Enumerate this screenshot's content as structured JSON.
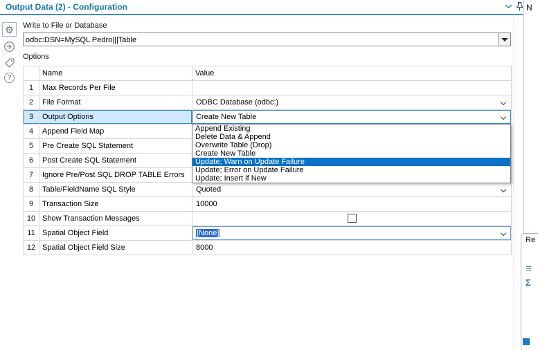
{
  "icons": {
    "gear": "⚙",
    "help": "?",
    "list": "≡",
    "sigma": "Σ"
  },
  "panel": {
    "title": "Output Data (2) - Configuration"
  },
  "write_section": {
    "label": "Write to File or Database",
    "connection_value": "odbc:DSN=MySQL Pedro|||Table"
  },
  "options_section": {
    "label": "Options",
    "headers": {
      "name": "Name",
      "value": "Value"
    },
    "rows": [
      {
        "num": "1",
        "name": "Max Records Per File",
        "value": ""
      },
      {
        "num": "2",
        "name": "File Format",
        "value": "ODBC Database (odbc:)"
      },
      {
        "num": "3",
        "name": "Output Options",
        "value": "Create New Table"
      },
      {
        "num": "4",
        "name": "Append Field Map",
        "value": ""
      },
      {
        "num": "5",
        "name": "Pre Create SQL Statement",
        "value": ""
      },
      {
        "num": "6",
        "name": "Post Create SQL Statement",
        "value": ""
      },
      {
        "num": "7",
        "name": "Ignore Pre/Post SQL DROP TABLE Errors",
        "value": ""
      },
      {
        "num": "8",
        "name": "Table/FieldName SQL Style",
        "value": "Quoted"
      },
      {
        "num": "9",
        "name": "Transaction Size",
        "value": "10000"
      },
      {
        "num": "10",
        "name": "Show Transaction Messages",
        "value": ""
      },
      {
        "num": "11",
        "name": "Spatial Object Field",
        "value": "[None]"
      },
      {
        "num": "12",
        "name": "Spatial Object Field Size",
        "value": "8000"
      }
    ]
  },
  "output_options_dropdown": {
    "items": [
      "Append Existing",
      "Delete Data & Append",
      "Overwrite Table (Drop)",
      "Create New Table",
      "Update; Warn on Update Failure",
      "Update; Error on Update Failure",
      "Update; Insert if New"
    ],
    "highlighted_item": "Update; Warn on Update Failure"
  },
  "right_side": {
    "top_text": "N",
    "results_header_text": "Re"
  },
  "colors": {
    "title_text": "#1379a9",
    "accent_line": "#3e8ec9",
    "row_selection_bg": "#cfe8ff",
    "row_selection_border": "#3a86c8",
    "dropdown_highlight_bg": "#0a72c8",
    "text_selection_bg": "#2e6bc6"
  }
}
